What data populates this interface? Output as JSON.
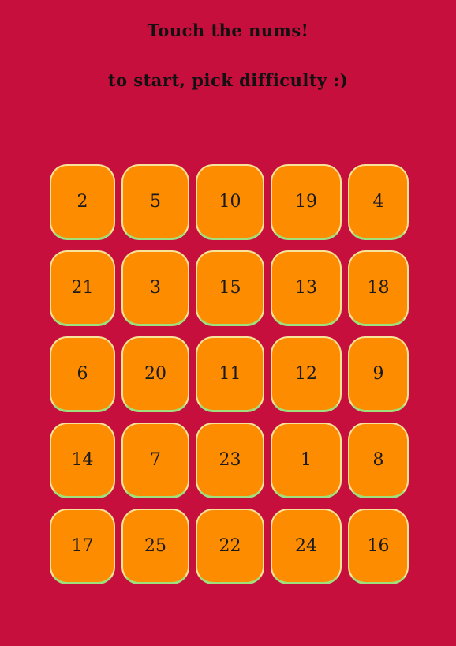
{
  "header": {
    "title": "Touch the nums!",
    "subtitle": "to start, pick difficulty :)"
  },
  "grid": {
    "rows": [
      [
        "2",
        "5",
        "10",
        "19",
        "4"
      ],
      [
        "21",
        "3",
        "15",
        "13",
        "18"
      ],
      [
        "6",
        "20",
        "11",
        "12",
        "9"
      ],
      [
        "14",
        "7",
        "23",
        "1",
        "8"
      ],
      [
        "17",
        "25",
        "22",
        "24",
        "16"
      ]
    ]
  },
  "colors": {
    "background": "#c60f3c",
    "tile": "#fd8c00",
    "tile_border": "#f6e49a",
    "tile_shadow": "#9fe07c"
  }
}
